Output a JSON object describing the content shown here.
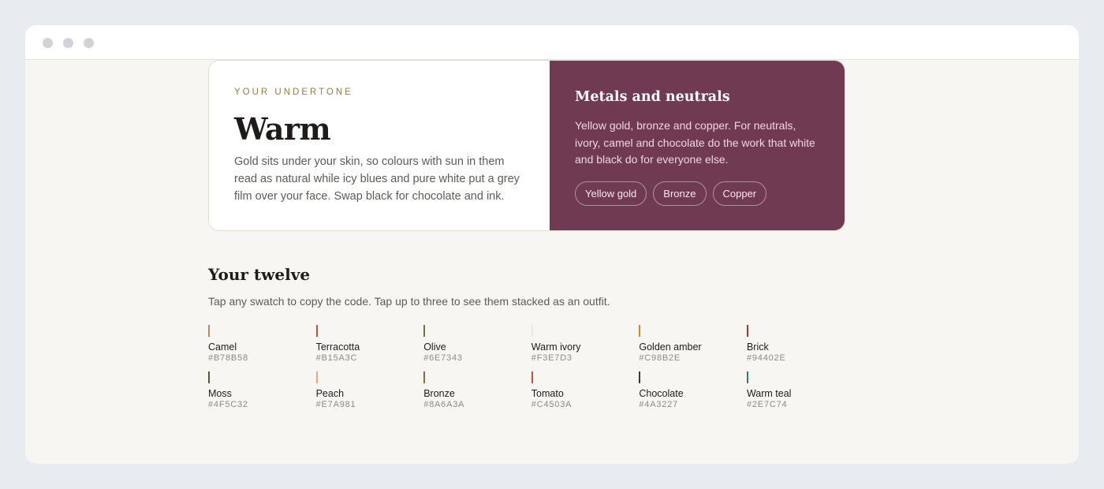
{
  "undertone": {
    "eyebrow": "YOUR UNDERTONE",
    "title": "Warm",
    "description": "Gold sits under your skin, so colours with sun in them read as natural while icy blues and pure white put a grey film over your face. Swap black for chocolate and ink."
  },
  "metals": {
    "title": "Metals and neutrals",
    "description": "Yellow gold, bronze and copper. For neutrals, ivory, camel and chocolate do the work that white and black do for everyone else.",
    "chips": [
      "Yellow gold",
      "Bronze",
      "Copper"
    ]
  },
  "twelve": {
    "title": "Your twelve",
    "subtitle": "Tap any swatch to copy the code. Tap up to three to see them stacked as an outfit.",
    "swatches": [
      {
        "name": "Camel",
        "hex": "#B78B58"
      },
      {
        "name": "Terracotta",
        "hex": "#B15A3C"
      },
      {
        "name": "Olive",
        "hex": "#6E7343"
      },
      {
        "name": "Warm ivory",
        "hex": "#F3E7D3"
      },
      {
        "name": "Golden amber",
        "hex": "#C98B2E"
      },
      {
        "name": "Brick",
        "hex": "#94402E"
      },
      {
        "name": "Moss",
        "hex": "#4F5C32"
      },
      {
        "name": "Peach",
        "hex": "#E7A981"
      },
      {
        "name": "Bronze",
        "hex": "#8A6A3A"
      },
      {
        "name": "Tomato",
        "hex": "#C4503A"
      },
      {
        "name": "Chocolate",
        "hex": "#4A3227"
      },
      {
        "name": "Warm teal",
        "hex": "#2E7C74"
      }
    ]
  },
  "colors": {
    "accent_plum": "#6F3A52",
    "eyebrow_gold": "#9C7B3A"
  }
}
